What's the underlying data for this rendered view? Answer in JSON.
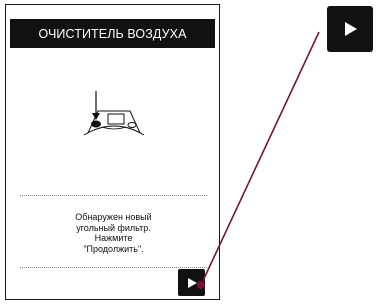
{
  "app": {
    "title": "ОЧИСТИТЕЛЬ ВОЗДУХА"
  },
  "message": {
    "lines": [
      "Обнаружен новый",
      "угольный фильтр.",
      "Нажмите",
      "\"Продолжить\"."
    ]
  },
  "buttons": {
    "continue_icon": "play-triangle-icon",
    "callout_icon": "play-triangle-icon"
  },
  "illustration": {
    "icon": "air-purifier-filter-icon"
  },
  "colors": {
    "background": "#ffffff",
    "title_bar": "#111111",
    "title_text": "#ffffff",
    "callout_line": "#7a1232",
    "callout_dot": "#7a1232"
  }
}
